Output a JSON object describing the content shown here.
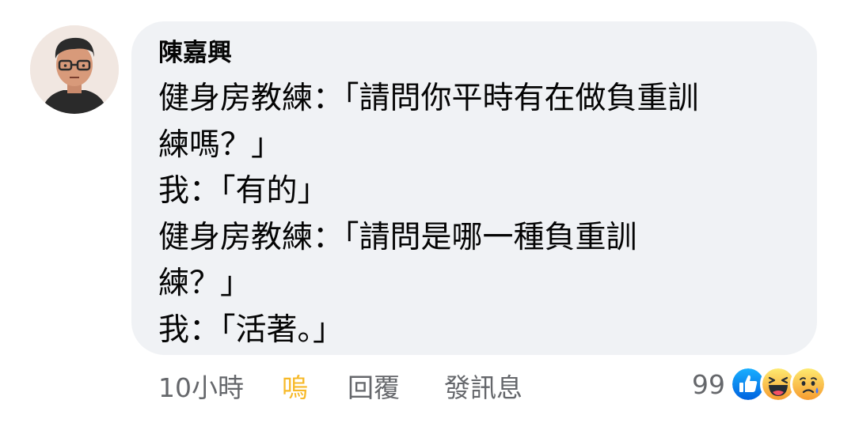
{
  "comment": {
    "author": "陳嘉興",
    "lines": [
      "健身房教練：「請問你平時有在做負重訓",
      "練嗎？」",
      "我：「有的」",
      "健身房教練：「請問是哪一種負重訓",
      "練？」",
      "我：「活著。」"
    ]
  },
  "actions": {
    "time": "10小時",
    "like_label": "嗚",
    "reply_label": "回覆",
    "message_label": "發訊息"
  },
  "reactions": {
    "count": "99",
    "icons": [
      "like-icon",
      "haha-icon",
      "sad-icon"
    ]
  },
  "colors": {
    "bubble_background": "#f0f2f5",
    "reaction_active": "#f7b928",
    "meta_text": "#65676b",
    "like_blue": "#1877f2"
  }
}
